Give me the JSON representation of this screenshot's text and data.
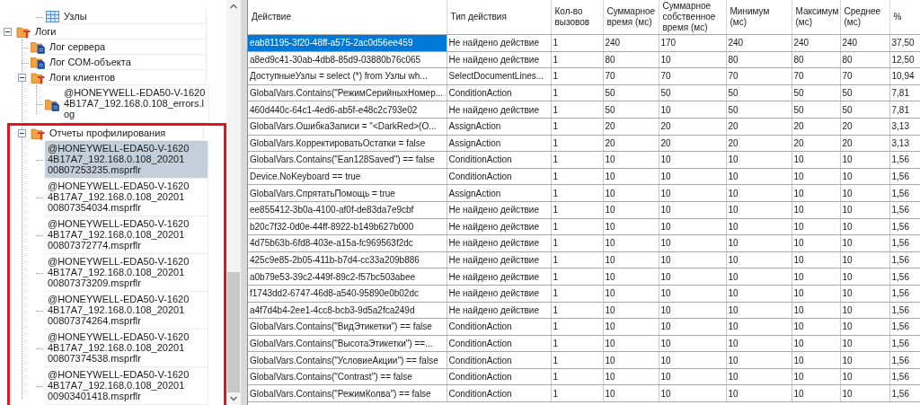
{
  "tree": {
    "orphan_items": [
      {
        "label": "Узлы",
        "kind": "table",
        "selected": false,
        "highlighted": false
      }
    ],
    "items": [
      {
        "label": "Логи",
        "kind": "group",
        "expanded": true,
        "selected": false,
        "highlighted": false,
        "children": [
          {
            "label": "Лог сервера",
            "kind": "log",
            "selected": false,
            "highlighted": false
          },
          {
            "label": "Лог COM-объекта",
            "kind": "log",
            "selected": false,
            "highlighted": false
          },
          {
            "label": "Логи клиентов",
            "kind": "group",
            "expanded": true,
            "selected": false,
            "highlighted": false,
            "children": [
              {
                "label": "@HONEYWELL-EDA50-V-16204B17A7_192.168.0.108_errors.log",
                "kind": "log",
                "selected": false,
                "highlighted": false
              }
            ]
          },
          {
            "label": "Отчеты профилирования",
            "kind": "group",
            "expanded": true,
            "selected": false,
            "highlighted": true,
            "children": [
              {
                "label": "@HONEYWELL-EDA50-V-16204B17A7_192.168.0.108_2020100807253235.msprflr",
                "kind": "profile",
                "selected": true,
                "highlighted": false
              },
              {
                "label": "@HONEYWELL-EDA50-V-16204B17A7_192.168.0.108_2020100807354034.msprflr",
                "kind": "profile",
                "selected": false,
                "highlighted": false
              },
              {
                "label": "@HONEYWELL-EDA50-V-16204B17A7_192.168.0.108_2020100807372774.msprflr",
                "kind": "profile",
                "selected": false,
                "highlighted": false
              },
              {
                "label": "@HONEYWELL-EDA50-V-16204B17A7_192.168.0.108_2020100807373209.msprflr",
                "kind": "profile",
                "selected": false,
                "highlighted": false
              },
              {
                "label": "@HONEYWELL-EDA50-V-16204B17A7_192.168.0.108_2020100807374264.msprflr",
                "kind": "profile",
                "selected": false,
                "highlighted": false
              },
              {
                "label": "@HONEYWELL-EDA50-V-16204B17A7_192.168.0.108_2020100807374538.msprflr",
                "kind": "profile",
                "selected": false,
                "highlighted": false
              },
              {
                "label": "@HONEYWELL-EDA50-V-16204B17A7_192.168.0.108_2020100903401418.msprflr",
                "kind": "profile",
                "selected": false,
                "highlighted": false
              }
            ]
          }
        ]
      }
    ]
  },
  "grid": {
    "columns": [
      "Действие",
      "Тип действия",
      "Кол-во вызовов",
      "Суммарное время (мс)",
      "Суммарное собственное время (мс)",
      "Минимум (мс)",
      "Максимум (мс)",
      "Среднее (мс)",
      "%"
    ],
    "rows": [
      {
        "selected": true,
        "cells": [
          "eab81195-3f20-48ff-a575-2ac0d56ee459",
          "Не найдено действие",
          "1",
          "240",
          "170",
          "240",
          "240",
          "240",
          "37,50"
        ]
      },
      {
        "selected": false,
        "cells": [
          "a8ed9c41-30ab-4db8-85d9-03880b76c065",
          "Не найдено действие",
          "1",
          "80",
          "10",
          "80",
          "80",
          "80",
          "12,50"
        ]
      },
      {
        "selected": false,
        "cells": [
          "ДоступныеУзлы = select (*) from Узлы wh...",
          "SelectDocumentLines...",
          "1",
          "70",
          "70",
          "70",
          "70",
          "70",
          "10,94"
        ]
      },
      {
        "selected": false,
        "cells": [
          "GlobalVars.Contains(\"РежимСерийныхНомер...",
          "ConditionAction",
          "1",
          "50",
          "50",
          "50",
          "50",
          "50",
          "7,81"
        ]
      },
      {
        "selected": false,
        "cells": [
          "460d440c-64c1-4ed6-ab5f-e48c2c793e02",
          "Не найдено действие",
          "1",
          "50",
          "10",
          "50",
          "50",
          "50",
          "7,81"
        ]
      },
      {
        "selected": false,
        "cells": [
          "GlobalVars.ОшибкаЗаписи = \"<DarkRed>(О...",
          "AssignAction",
          "1",
          "20",
          "20",
          "20",
          "20",
          "20",
          "3,13"
        ]
      },
      {
        "selected": false,
        "cells": [
          "GlobalVars.КорректироватьОстатки = false",
          "AssignAction",
          "1",
          "20",
          "20",
          "20",
          "20",
          "20",
          "3,13"
        ]
      },
      {
        "selected": false,
        "cells": [
          "GlobalVars.Contains(\"Ean128Saved\") == false",
          "ConditionAction",
          "1",
          "10",
          "10",
          "10",
          "10",
          "10",
          "1,56"
        ]
      },
      {
        "selected": false,
        "cells": [
          "Device.NoKeyboard == true",
          "ConditionAction",
          "1",
          "10",
          "10",
          "10",
          "10",
          "10",
          "1,56"
        ]
      },
      {
        "selected": false,
        "cells": [
          "GlobalVars.СпрятатьПомощь = true",
          "AssignAction",
          "1",
          "10",
          "10",
          "10",
          "10",
          "10",
          "1,56"
        ]
      },
      {
        "selected": false,
        "cells": [
          "ee855412-3b0a-4100-af0f-de83da7e9cbf",
          "Не найдено действие",
          "1",
          "10",
          "10",
          "10",
          "10",
          "10",
          "1,56"
        ]
      },
      {
        "selected": false,
        "cells": [
          "b20c7f32-0d0e-44ff-8922-b149b627b000",
          "Не найдено действие",
          "1",
          "10",
          "10",
          "10",
          "10",
          "10",
          "1,56"
        ]
      },
      {
        "selected": false,
        "cells": [
          "4d75b63b-6fd8-403e-a15a-fc969563f2dc",
          "Не найдено действие",
          "1",
          "10",
          "10",
          "10",
          "10",
          "10",
          "1,56"
        ]
      },
      {
        "selected": false,
        "cells": [
          "425c9e85-2b05-411b-b7d4-cc33a209b886",
          "Не найдено действие",
          "1",
          "10",
          "10",
          "10",
          "10",
          "10",
          "1,56"
        ]
      },
      {
        "selected": false,
        "cells": [
          "a0b79e53-39c2-449f-89c2-f57bc503abee",
          "Не найдено действие",
          "1",
          "10",
          "10",
          "10",
          "10",
          "10",
          "1,56"
        ]
      },
      {
        "selected": false,
        "cells": [
          "f1743dd2-6747-46d8-a540-95890e0b02dc",
          "Не найдено действие",
          "1",
          "10",
          "10",
          "10",
          "10",
          "10",
          "1,56"
        ]
      },
      {
        "selected": false,
        "cells": [
          "a4f7d4b4-2ee1-4cc8-bcb3-9d5a2fca249d",
          "Не найдено действие",
          "1",
          "10",
          "10",
          "10",
          "10",
          "10",
          "1,56"
        ]
      },
      {
        "selected": false,
        "cells": [
          "GlobalVars.Contains(\"ВидЭтикетки\") == false",
          "ConditionAction",
          "1",
          "10",
          "10",
          "10",
          "10",
          "10",
          "1,56"
        ]
      },
      {
        "selected": false,
        "cells": [
          "GlobalVars.Contains(\"ВысотаЭтикетки\") ==...",
          "ConditionAction",
          "1",
          "10",
          "10",
          "10",
          "10",
          "10",
          "1,56"
        ]
      },
      {
        "selected": false,
        "cells": [
          "GlobalVars.Contains(\"УсловиеАкции\") == false",
          "ConditionAction",
          "1",
          "10",
          "10",
          "10",
          "10",
          "10",
          "1,56"
        ]
      },
      {
        "selected": false,
        "cells": [
          "GlobalVars.Contains(\"Contrast\") == false",
          "ConditionAction",
          "1",
          "10",
          "10",
          "10",
          "10",
          "10",
          "1,56"
        ]
      },
      {
        "selected": false,
        "cells": [
          "GlobalVars.Contains(\"РежимКолва\") == false",
          "ConditionAction",
          "1",
          "10",
          "10",
          "10",
          "10",
          "10",
          "1,56"
        ]
      }
    ]
  }
}
